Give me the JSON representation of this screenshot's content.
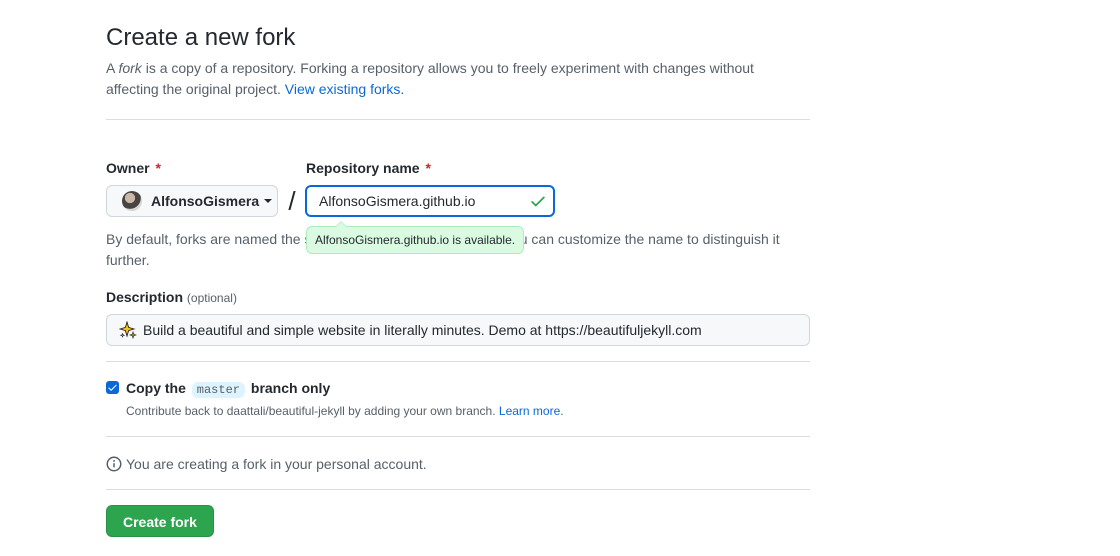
{
  "header": {
    "title": "Create a new fork",
    "subtitle_prefix": "A ",
    "subtitle_em": "fork",
    "subtitle_line": " is a copy of a repository. Forking a repository allows you to freely experiment with changes without affecting the original project. ",
    "view_forks_link": "View existing forks."
  },
  "form": {
    "owner_label": "Owner",
    "repo_label": "Repository name",
    "required_mark": "*",
    "owner_value": "AlfonsoGismera",
    "slash": "/",
    "repo_value": "AlfonsoGismera.github.io",
    "availability_tooltip": "AlfonsoGismera.github.io is available.",
    "naming_note": "By default, forks are named the same as their parent repository. You can customize the name to distinguish it further.",
    "description_label": "Description",
    "description_optional": "(optional)",
    "description_value": "Build a beautiful and simple website in literally minutes. Demo at https://beautifuljekyll.com",
    "copy_branch_prefix": "Copy the",
    "copy_branch_name": "master",
    "copy_branch_suffix": "branch only",
    "copy_branch_checked": true,
    "contribute_text": "Contribute back to daattali/beautiful-jekyll by adding your own branch. ",
    "learn_more_link": "Learn more.",
    "info_text": "You are creating a fork in your personal account.",
    "create_button": "Create fork"
  },
  "colors": {
    "accent": "#0969da",
    "primary_button": "#2da44e",
    "success": "#2da44e",
    "required": "#cf222e",
    "tooltip_bg": "#dafbe1"
  },
  "icons": {
    "owner_avatar": "avatar",
    "dropdown": "caret-down-icon",
    "valid": "check-icon",
    "description_emoji": "sparkles-icon",
    "info": "info-icon"
  }
}
